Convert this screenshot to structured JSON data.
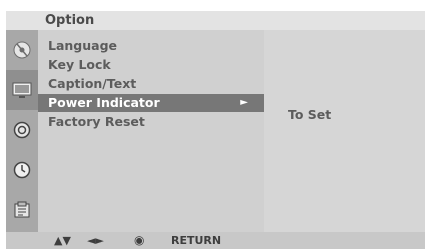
{
  "menu": {
    "title": "Option",
    "items": [
      {
        "label": "Language"
      },
      {
        "label": "Key Lock"
      },
      {
        "label": "Caption/Text"
      },
      {
        "label": "Power Indicator",
        "selected": true
      },
      {
        "label": "Factory Reset"
      }
    ],
    "selected_arrow": "►"
  },
  "submenu": {
    "value": "To Set"
  },
  "icons": [
    {
      "name": "sound-icon",
      "selected": false
    },
    {
      "name": "screen-icon",
      "selected": true
    },
    {
      "name": "setup-icon",
      "selected": false
    },
    {
      "name": "clock-icon",
      "selected": false
    },
    {
      "name": "lock-icon",
      "selected": false
    }
  ],
  "footer": {
    "updown": "▲▼",
    "leftright": "◄►",
    "ok": "◉",
    "return_label": "RETURN"
  },
  "colors": {
    "selected_bg": "#777777",
    "text": "#5c5c5c",
    "rail": "#a8a8a8"
  }
}
